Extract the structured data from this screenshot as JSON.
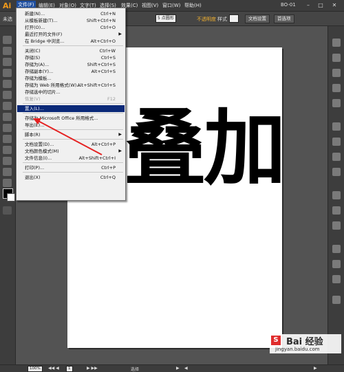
{
  "app": {
    "logo": "Ai",
    "window_title": "BO-01",
    "window_controls": [
      "–",
      "□",
      "✕"
    ]
  },
  "menubar": {
    "items": [
      {
        "label": "文件(F)",
        "active": true
      },
      {
        "label": "编辑(E)"
      },
      {
        "label": "对象(O)"
      },
      {
        "label": "文字(T)"
      },
      {
        "label": "选择(S)"
      },
      {
        "label": "效果(C)"
      },
      {
        "label": "视图(V)"
      },
      {
        "label": "窗口(W)"
      },
      {
        "label": "帮助(H)"
      }
    ]
  },
  "controlbar": {
    "selection_label": "未选",
    "stroke_point": "5 点圆形",
    "opacity_label": "不透明度",
    "style_label": "样式",
    "doc_setup_button": "文档设置",
    "preferences_button": "首选项"
  },
  "file_menu": {
    "items": [
      {
        "label": "新建(N)...",
        "shortcut": "Ctrl+N"
      },
      {
        "label": "从模板新建(T)...",
        "shortcut": "Shift+Ctrl+N"
      },
      {
        "label": "打开(O)...",
        "shortcut": "Ctrl+O"
      },
      {
        "label": "最近打开的文件(F)",
        "shortcut": "",
        "submenu": true
      },
      {
        "label": "在 Bridge 中浏览...",
        "shortcut": "Alt+Ctrl+O"
      },
      {
        "sep": true
      },
      {
        "label": "关闭(C)",
        "shortcut": "Ctrl+W"
      },
      {
        "label": "存储(S)",
        "shortcut": "Ctrl+S"
      },
      {
        "label": "存储为(A)...",
        "shortcut": "Shift+Ctrl+S"
      },
      {
        "label": "存储副本(Y)...",
        "shortcut": "Alt+Ctrl+S"
      },
      {
        "label": "存储为模板...",
        "shortcut": ""
      },
      {
        "label": "存储为 Web 所用格式(W)...",
        "shortcut": "Alt+Shift+Ctrl+S"
      },
      {
        "label": "存储选中的切片...",
        "shortcut": ""
      },
      {
        "label": "恢复(V)",
        "shortcut": "F12",
        "disabled": true
      },
      {
        "sep": true
      },
      {
        "label": "置入(L)...",
        "shortcut": "",
        "highlight": true
      },
      {
        "sep": true
      },
      {
        "label": "存储为 Microsoft Office 所用格式...",
        "shortcut": ""
      },
      {
        "label": "导出(E)...",
        "shortcut": ""
      },
      {
        "sep": true
      },
      {
        "label": "脚本(R)",
        "shortcut": "",
        "submenu": true
      },
      {
        "sep": true
      },
      {
        "label": "文档设置(D)...",
        "shortcut": "Alt+Ctrl+P"
      },
      {
        "label": "文档颜色模式(M)",
        "shortcut": "",
        "submenu": true
      },
      {
        "label": "文件信息(I)...",
        "shortcut": "Alt+Shift+Ctrl+I"
      },
      {
        "sep": true
      },
      {
        "label": "打印(P)...",
        "shortcut": "Ctrl+P"
      },
      {
        "sep": true
      },
      {
        "label": "退出(X)",
        "shortcut": "Ctrl+Q"
      }
    ]
  },
  "canvas": {
    "artwork_text": "叠加"
  },
  "statusbar": {
    "zoom": "100%",
    "artboard_number": "1",
    "mode_label": "选择"
  },
  "watermark": {
    "brand_letter": "S",
    "brand_text": "Bai 经验",
    "url": "jingyan.baidu.com"
  }
}
